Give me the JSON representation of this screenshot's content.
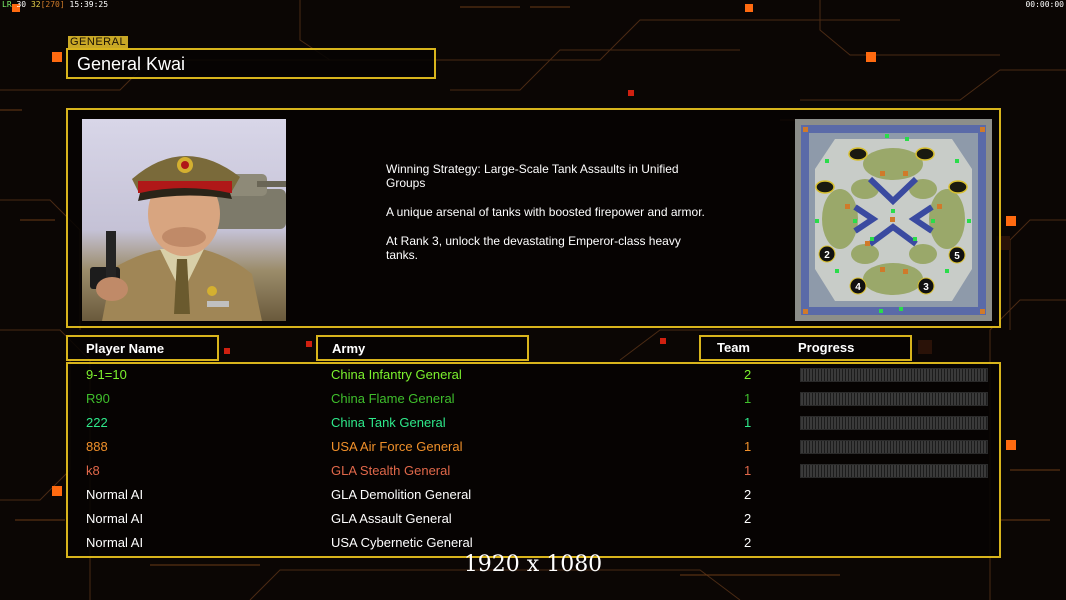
{
  "top_status": {
    "a": "LR",
    "b": "30",
    "c": "32",
    "d": "[270]",
    "e": "15:39:25"
  },
  "clock": "00:00:00",
  "general_tag": "GENERAL",
  "general_name": "General Kwai",
  "strategy": [
    "Winning Strategy: Large-Scale Tank Assaults in Unified Groups",
    "A unique arsenal of tanks with boosted firepower and armor.",
    "At Rank 3, unlock the devastating Emperor-class heavy tanks."
  ],
  "minimap": {
    "markers": [
      "2",
      "5",
      "4",
      "3"
    ]
  },
  "headers": {
    "player_name": "Player Name",
    "army": "Army",
    "team": "Team",
    "progress": "Progress"
  },
  "players": [
    {
      "name": "9-1=10",
      "army": "China Infantry General",
      "team": "2",
      "color": "#7cf22e",
      "progress": true
    },
    {
      "name": "R90",
      "army": "China Flame General",
      "team": "1",
      "color": "#3fbf2c",
      "progress": true
    },
    {
      "name": "222",
      "army": "China Tank General",
      "team": "1",
      "color": "#2ee88a",
      "progress": true
    },
    {
      "name": "888",
      "army": "USA Air Force General",
      "team": "1",
      "color": "#f0902a",
      "progress": true
    },
    {
      "name": "k8",
      "army": "GLA Stealth General",
      "team": "1",
      "color": "#e0684a",
      "progress": true
    },
    {
      "name": "Normal AI",
      "army": "GLA Demolition General",
      "team": "2",
      "color": "#ffffff",
      "progress": false
    },
    {
      "name": "Normal AI",
      "army": "GLA Assault General",
      "team": "2",
      "color": "#ffffff",
      "progress": false
    },
    {
      "name": "Normal AI",
      "army": "USA Cybernetic General",
      "team": "2",
      "color": "#ffffff",
      "progress": false
    }
  ],
  "resolution_overlay": "1920 x 1080",
  "colors": {
    "frame": "#d8b41c",
    "accent": "#ff7a10"
  }
}
